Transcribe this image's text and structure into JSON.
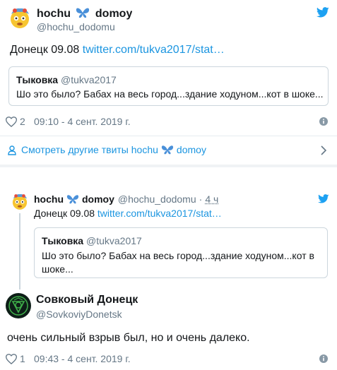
{
  "tweet1": {
    "name_a": "hochu",
    "name_b": "domoy",
    "handle": "@hochu_dodomu",
    "text": "Донецк 09.08 ",
    "link": "twitter.com/tukva2017/stat…",
    "quote": {
      "name": "Тыковка",
      "handle": "@tukva2017",
      "text": "Шо это было? Бабах на весь город...здание ходуном...кот в шоке..."
    },
    "likes": "2",
    "time": "09:10 - 4 сент. 2019 г."
  },
  "more_tweets": {
    "label_a": "Смотреть другие твиты hochu",
    "label_b": "domoy"
  },
  "thread": {
    "name_a": "hochu",
    "name_b": "domoy",
    "handle": "@hochu_dodomu",
    "sep": "·",
    "age": "4 ч",
    "text": "Донецк 09.08 ",
    "link": "twitter.com/tukva2017/stat…",
    "quote": {
      "name": "Тыковка",
      "handle": "@tukva2017",
      "text_line1": "Шо это было? Бабах на весь город...здание ходуном...кот в",
      "text_line2": "шоке..."
    }
  },
  "reply": {
    "name": "Совковый Донецк",
    "handle": "@SovkoviyDonetsk",
    "text": "очень сильный взрыв был, но и очень далеко.",
    "likes": "1",
    "time": "09:43 - 4 сент. 2019 г."
  },
  "colors": {
    "accent": "#1da1f2",
    "link": "#1b95e0",
    "muted": "#657786",
    "border": "#ccd6dd"
  },
  "icons": [
    "emoji-avatar",
    "butterfly-icon",
    "twitter-bird-icon",
    "heart-icon",
    "info-icon",
    "user-icon",
    "chevron-right-icon",
    "seal-avatar"
  ]
}
